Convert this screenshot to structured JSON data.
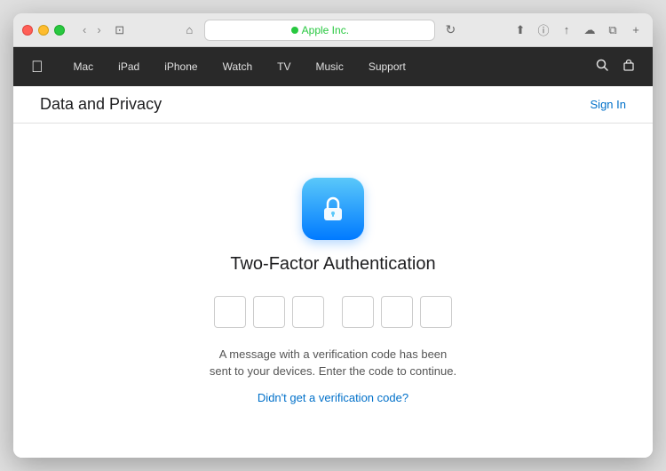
{
  "browser": {
    "address_bar_text": "Apple Inc.",
    "address_color": "#28c840"
  },
  "nav": {
    "apple_logo": "",
    "items": [
      {
        "label": "Mac"
      },
      {
        "label": "iPad"
      },
      {
        "label": "iPhone"
      },
      {
        "label": "Watch"
      },
      {
        "label": "TV"
      },
      {
        "label": "Music"
      },
      {
        "label": "Support"
      }
    ]
  },
  "sub_header": {
    "title": "Data and Privacy",
    "sign_in": "Sign In"
  },
  "main": {
    "two_factor_title": "Two-Factor Authentication",
    "verification_message": "A message with a verification code has been sent to your devices. Enter the code to continue.",
    "resend_link": "Didn't get a verification code?"
  }
}
